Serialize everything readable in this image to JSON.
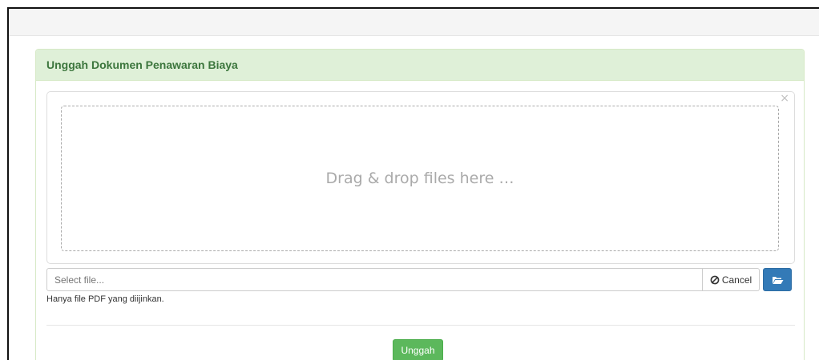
{
  "panel": {
    "title": "Unggah Dokumen Penawaran Biaya"
  },
  "preview": {
    "close_symbol": "×",
    "drop_text": "Drag & drop files here …"
  },
  "file_input": {
    "placeholder": "Select file...",
    "cancel_label": "Cancel",
    "cancel_icon": "ban-icon",
    "browse_icon": "folder-open-icon",
    "help_text": "Hanya file PDF yang diijinkan."
  },
  "submit": {
    "label": "Unggah"
  },
  "colors": {
    "heading_bg": "#dff0d8",
    "heading_text": "#3c763d",
    "browse_bg": "#337ab7",
    "submit_bg": "#5cb85c"
  }
}
